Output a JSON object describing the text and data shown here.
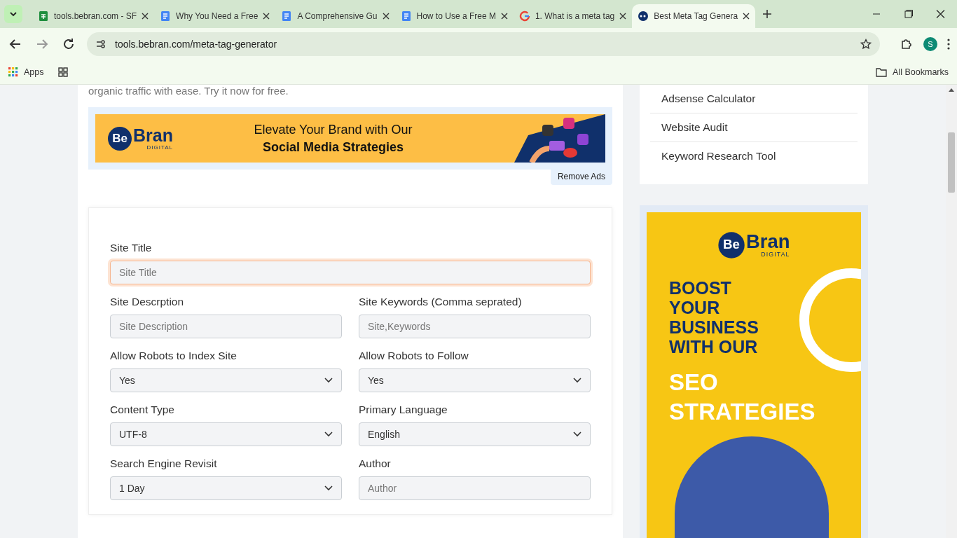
{
  "browser": {
    "tabs": [
      {
        "title": "tools.bebran.com - SF",
        "kind": "sheets",
        "selected": false
      },
      {
        "title": "Why You Need a Free",
        "kind": "docs",
        "selected": false
      },
      {
        "title": "A Comprehensive Gu",
        "kind": "docs",
        "selected": false
      },
      {
        "title": "How to Use a Free M",
        "kind": "docs",
        "selected": false
      },
      {
        "title": "1. What is a meta tag",
        "kind": "google",
        "selected": false
      },
      {
        "title": "Best Meta Tag Genera",
        "kind": "site",
        "selected": true
      }
    ],
    "address": "tools.bebran.com/meta-tag-generator",
    "profile_initial": "S",
    "bookmarks": {
      "apps": "Apps",
      "all": "All Bookmarks"
    }
  },
  "page": {
    "intro": "organic traffic with ease. Try it now for free.",
    "banner_ad": {
      "logo": "Be",
      "logo_word": "Bran",
      "logo_sub": "DIGITAL",
      "line1": "Elevate Your Brand with Our",
      "line2": "Social Media Strategies",
      "remove": "Remove Ads"
    },
    "form": {
      "fields": [
        {
          "label": "Site Title",
          "kind": "text",
          "placeholder": "Site Title",
          "focused": true,
          "wide": true
        },
        {
          "label": "Site Descrption",
          "kind": "text",
          "placeholder": "Site Description",
          "focused": false,
          "wide": false
        },
        {
          "label": "Site Keywords (Comma seprated)",
          "kind": "text",
          "placeholder": "Site,Keywords",
          "focused": false,
          "wide": false
        },
        {
          "label": "Allow Robots to Index Site",
          "kind": "select",
          "value": "Yes",
          "focused": false,
          "wide": false
        },
        {
          "label": "Allow Robots to Follow",
          "kind": "select",
          "value": "Yes",
          "focused": false,
          "wide": false
        },
        {
          "label": "Content Type",
          "kind": "select",
          "value": "UTF-8",
          "focused": false,
          "wide": false
        },
        {
          "label": "Primary Language",
          "kind": "select",
          "value": "English",
          "focused": false,
          "wide": false
        },
        {
          "label": "Search Engine Revisit",
          "kind": "select",
          "value": "1 Day",
          "focused": false,
          "wide": false
        },
        {
          "label": "Author",
          "kind": "text",
          "placeholder": "Author",
          "focused": false,
          "wide": false
        }
      ]
    },
    "sidebar": {
      "links": [
        "Adsense Calculator",
        "Website Audit",
        "Keyword Research Tool"
      ],
      "side_ad": {
        "logo": "Be",
        "logo_word": "Bran",
        "logo_sub": "DIGITAL",
        "lines": [
          "BOOST",
          "YOUR",
          "BUSINESS",
          "WITH OUR"
        ],
        "big": [
          "SEO",
          "STRATEGIES"
        ]
      }
    }
  }
}
